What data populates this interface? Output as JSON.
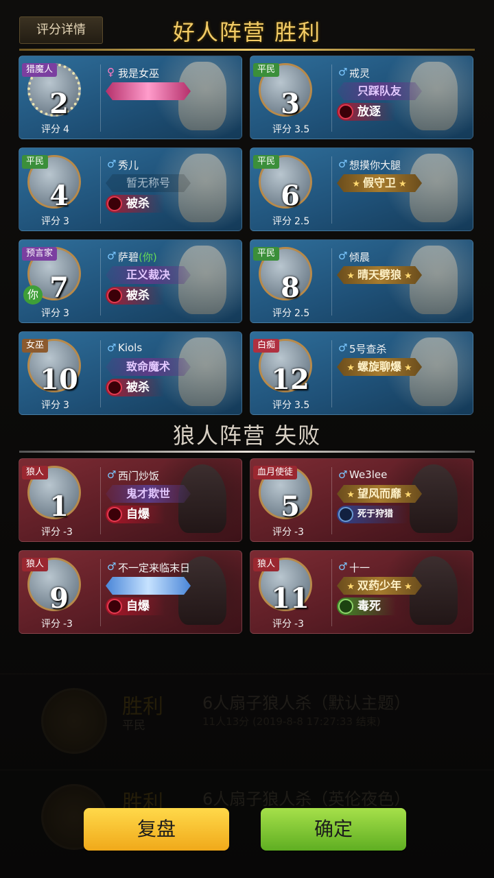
{
  "background_list": [
    {
      "result": "胜利",
      "role": "平民",
      "title": "6人扇子狼人杀（默认主题）",
      "sub": "11人13分 (2019-8-8 17:27:33 结束)"
    },
    {
      "result": "胜利",
      "role": "平民",
      "title": "6人扇子狼人杀（英伦夜色）",
      "sub": ""
    }
  ],
  "header": {
    "detail_tab": "评分详情",
    "good_camp_title": "好人阵营 胜利",
    "bad_camp_title": "狼人阵营 失败"
  },
  "score_label": "评分",
  "good_players": [
    {
      "role": "猎魔人",
      "role_color": "#7b3fa0",
      "seat": "2",
      "gender": "♀",
      "gender_type": "female",
      "name": "我是女巫",
      "name_you": "",
      "title": "",
      "title_style": "pink",
      "fate": "",
      "score": "4",
      "you": false,
      "wreath": true
    },
    {
      "role": "平民",
      "role_color": "#3b8f3a",
      "seat": "3",
      "gender": "♂",
      "gender_type": "male",
      "name": "戒灵",
      "name_you": "",
      "title": "只踩队友",
      "title_style": "purple",
      "fate": "放逐",
      "score": "3.5",
      "you": false,
      "wreath": false
    },
    {
      "role": "平民",
      "role_color": "#3b8f3a",
      "seat": "4",
      "gender": "♂",
      "gender_type": "male",
      "name": "秀儿",
      "name_you": "",
      "title": "暂无称号",
      "title_style": "none",
      "fate": "被杀",
      "score": "3",
      "you": false,
      "wreath": false
    },
    {
      "role": "平民",
      "role_color": "#3b8f3a",
      "seat": "6",
      "gender": "♂",
      "gender_type": "male",
      "name": "想摸你大腿",
      "name_you": "",
      "title": "假守卫",
      "title_style": "gold",
      "fate": "",
      "score": "2.5",
      "you": false,
      "wreath": false
    },
    {
      "role": "预言家",
      "role_color": "#7b3fa0",
      "seat": "7",
      "gender": "♂",
      "gender_type": "male",
      "name": "萨碧",
      "name_you": "(你)",
      "title": "正义裁决",
      "title_style": "purple",
      "fate": "被杀",
      "score": "3",
      "you": true,
      "you_label": "你",
      "wreath": false
    },
    {
      "role": "平民",
      "role_color": "#3b8f3a",
      "seat": "8",
      "gender": "♂",
      "gender_type": "male",
      "name": "倾晨",
      "name_you": "",
      "title": "晴天劈狼",
      "title_style": "gold",
      "fate": "",
      "score": "2.5",
      "you": false,
      "wreath": false
    },
    {
      "role": "女巫",
      "role_color": "#8c5a2e",
      "seat": "10",
      "gender": "♂",
      "gender_type": "male",
      "name": "Kiols",
      "name_you": "",
      "title": "致命魔术",
      "title_style": "purple",
      "fate": "被杀",
      "score": "3",
      "you": false,
      "wreath": false
    },
    {
      "role": "白痴",
      "role_color": "#b03040",
      "seat": "12",
      "gender": "♂",
      "gender_type": "male",
      "name": "5号查杀",
      "name_you": "",
      "title": "螺旋聊爆",
      "title_style": "gold",
      "fate": "",
      "score": "3.5",
      "you": false,
      "wreath": false
    }
  ],
  "bad_players": [
    {
      "role": "狼人",
      "role_color": "#9a2730",
      "seat": "1",
      "gender": "♂",
      "gender_type": "male",
      "name": "西门炒饭",
      "title": "鬼才欺世",
      "title_style": "purple",
      "fate": "自爆",
      "fate_style": "red",
      "score": "-3"
    },
    {
      "role": "血月使徒",
      "role_color": "#9a2730",
      "seat": "5",
      "gender": "♂",
      "gender_type": "male",
      "name": "We3lee",
      "title": "望风而靡",
      "title_style": "gold",
      "fate": "死于狩猎",
      "fate_style": "blue",
      "score": "-3"
    },
    {
      "role": "狼人",
      "role_color": "#9a2730",
      "seat": "9",
      "gender": "♂",
      "gender_type": "male",
      "name": "不一定来临末日",
      "title": "",
      "title_style": "special",
      "fate": "自爆",
      "fate_style": "red",
      "score": "-3"
    },
    {
      "role": "狼人",
      "role_color": "#9a2730",
      "seat": "11",
      "gender": "♂",
      "gender_type": "male",
      "name": "十一",
      "title": "双药少年",
      "title_style": "gold",
      "fate": "毒死",
      "fate_style": "green",
      "score": "-3"
    }
  ],
  "buttons": {
    "replay": "复盘",
    "confirm": "确定"
  },
  "colors": {
    "good_card": "#1f5178",
    "bad_card": "#5b1d25",
    "gold_title": "#f3cc66",
    "replay_button": "#f5c12b",
    "confirm_button": "#7cc437"
  }
}
